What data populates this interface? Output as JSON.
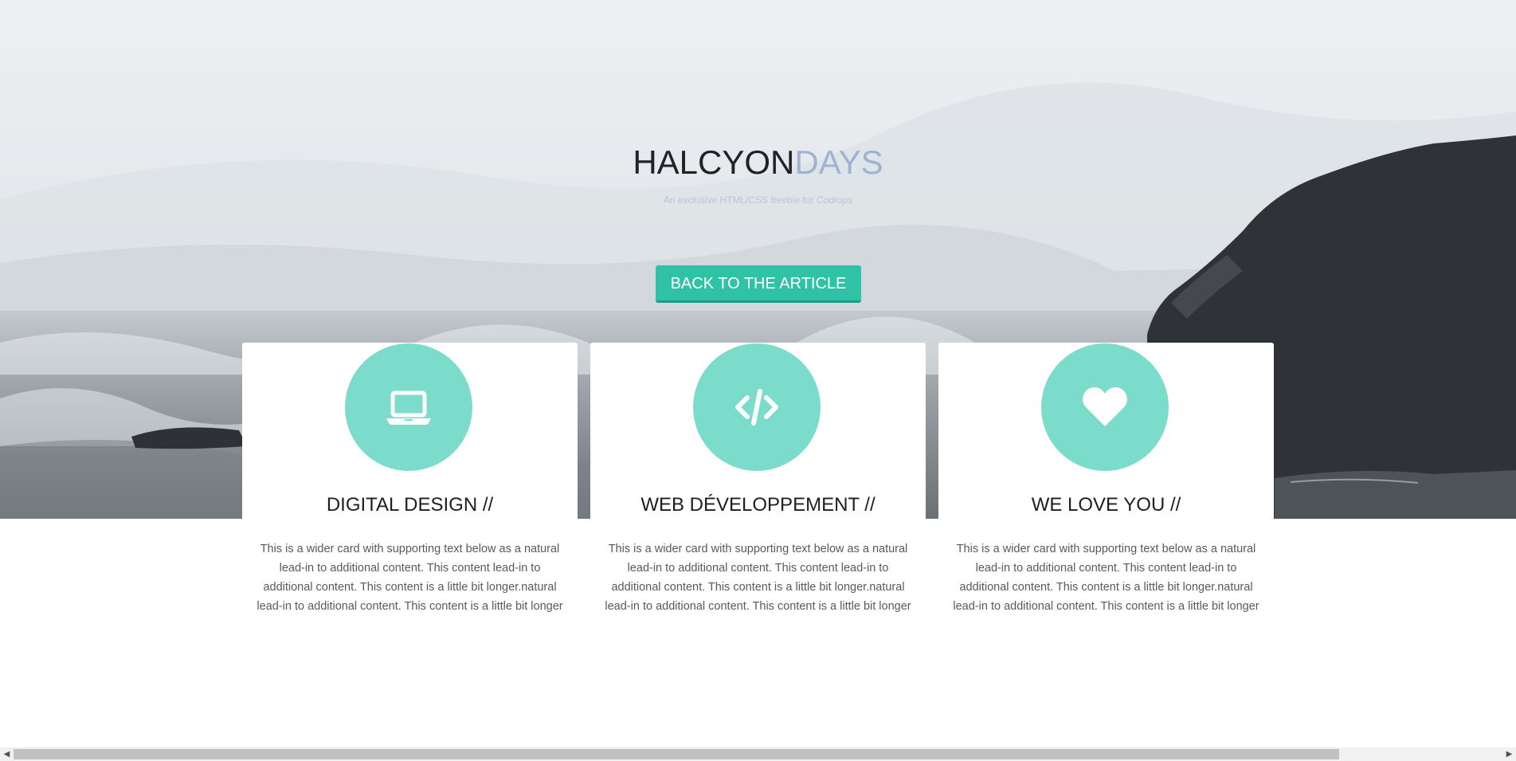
{
  "hero": {
    "title_main": "HALCYON",
    "title_accent": "DAYS",
    "subtitle_prefix": "An exclusive HTML/CSS freebie for ",
    "subtitle_brand": "Codrops",
    "back_button_label": "BACK TO THE ARTICLE"
  },
  "colors": {
    "accent": "#2fc2a6",
    "icon_circle": "#7bdccc",
    "title_accent": "#9fb2d2"
  },
  "cards": [
    {
      "icon": "laptop-icon",
      "title": "DIGITAL DESIGN //",
      "text": "This is a wider card with supporting text below as a natural lead-in to additional content. This content lead-in to additional content. This content is a little bit longer.natural lead-in to additional content. This content is a little bit longer"
    },
    {
      "icon": "code-icon",
      "title": "WEB DÉVELOPPEMENT //",
      "text": "This is a wider card with supporting text below as a natural lead-in to additional content. This content lead-in to additional content. This content is a little bit longer.natural lead-in to additional content. This content is a little bit longer"
    },
    {
      "icon": "heart-icon",
      "title": "WE LOVE YOU //",
      "text": "This is a wider card with supporting text below as a natural lead-in to additional content. This content lead-in to additional content. This content is a little bit longer.natural lead-in to additional content. This content is a little bit longer"
    }
  ],
  "scrollbar": {
    "left_arrow": "◀",
    "right_arrow": "▶"
  }
}
